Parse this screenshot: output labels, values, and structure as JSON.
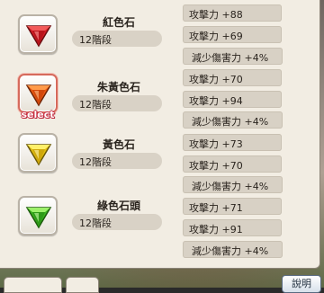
{
  "gems": [
    {
      "name": "紅色石",
      "level": "12階段",
      "icon": "red-gem-icon",
      "color": "#e0202a",
      "selected": false,
      "stats": [
        "攻擊力 +88",
        "攻擊力 +69",
        "減少傷害力 +4%"
      ]
    },
    {
      "name": "朱黃色石",
      "level": "12階段",
      "icon": "orange-gem-icon",
      "color": "#f06a1c",
      "selected": true,
      "select_label": "select",
      "stats": [
        "攻擊力 +70",
        "攻擊力 +94",
        "減少傷害力 +4%"
      ]
    },
    {
      "name": "黃色石",
      "level": "12階段",
      "icon": "yellow-gem-icon",
      "color": "#e8c81a",
      "selected": false,
      "stats": [
        "攻擊力 +73",
        "攻擊力 +70",
        "減少傷害力 +4%"
      ]
    },
    {
      "name": "綠色石頭",
      "level": "12階段",
      "icon": "green-gem-icon",
      "color": "#48c02a",
      "selected": false,
      "stats": [
        "攻擊力 +71",
        "攻擊力 +91",
        "減少傷害力 +4%"
      ]
    }
  ],
  "footer": {
    "help_label": "說明"
  }
}
